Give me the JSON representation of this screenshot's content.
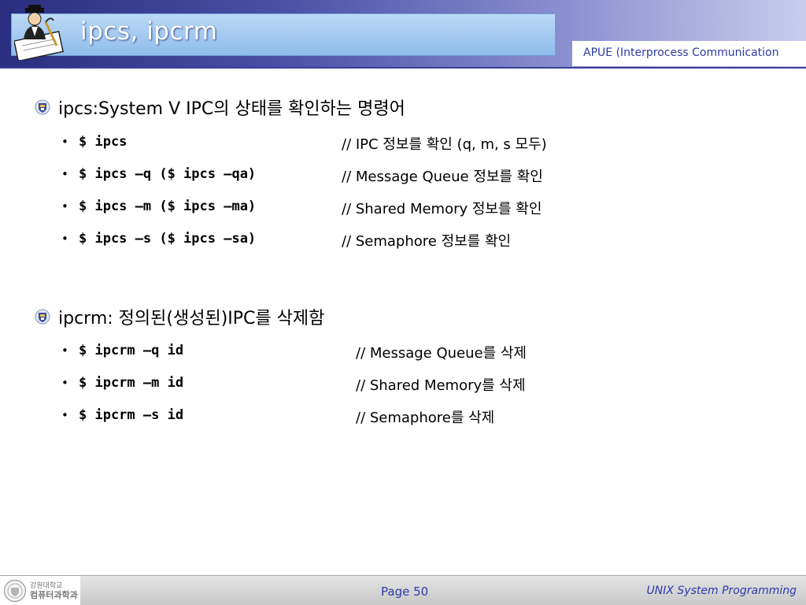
{
  "header": {
    "title": "ipcs, ipcrm",
    "subtitle": "APUE (Interprocess Communication"
  },
  "sections": [
    {
      "heading": "ipcs:System V IPC의 상태를 확인하는 명령어",
      "items": [
        {
          "cmd": "$ ipcs",
          "comment": "// IPC 정보를 확인 (q, m, s 모두)"
        },
        {
          "cmd": "$ ipcs –q ($ ipcs –qa)",
          "comment": "// Message Queue 정보를 확인"
        },
        {
          "cmd": "$ ipcs –m ($ ipcs –ma)",
          "comment": "// Shared Memory 정보를 확인"
        },
        {
          "cmd": "$ ipcs –s ($ ipcs –sa)",
          "comment": "// Semaphore 정보를 확인"
        }
      ]
    },
    {
      "heading": "ipcrm: 정의된(생성된)IPC를 삭제함",
      "items": [
        {
          "cmd": "$ ipcrm –q id",
          "comment": "// Message Queue를 삭제"
        },
        {
          "cmd": "$ ipcrm –m id",
          "comment": "// Shared Memory를 삭제"
        },
        {
          "cmd": "$ ipcrm –s id",
          "comment": "// Semaphore를 삭제"
        }
      ]
    }
  ],
  "bullet_glyph": "•",
  "footer": {
    "logo_line1": "강원대학교",
    "logo_line2": "컴퓨터과학과",
    "page": "Page 50",
    "course": "UNIX System Programming"
  },
  "icons": {
    "title_icon": "scholar-writing-icon",
    "bullet_icon": "university-emblem-icon",
    "footer_logo": "university-seal-icon"
  },
  "colors": {
    "header_dark": "#2a2e7e",
    "accent_blue": "#2c3aa8",
    "title_box": "#a8cbf1"
  }
}
